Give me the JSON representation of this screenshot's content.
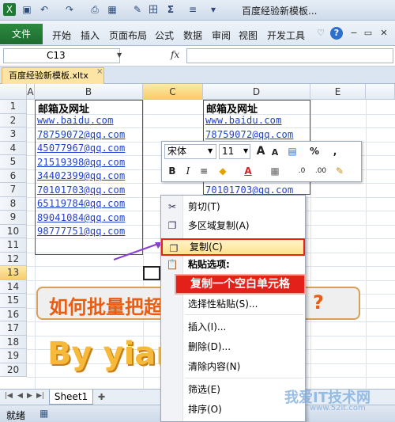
{
  "window": {
    "title": "百度经验新模板...",
    "quick_access": [
      "save-icon",
      "undo-icon",
      "redo-icon",
      "print-preview-icon",
      "table-icon",
      "format-painter-icon",
      "border-icon",
      "sum-icon",
      "align-icon"
    ],
    "sum_glyph": "Σ"
  },
  "ribbon": {
    "file_tab": "文件",
    "tabs": [
      "开始",
      "插入",
      "页面布局",
      "公式",
      "数据",
      "审阅",
      "视图",
      "开发工具"
    ],
    "accent": "#1e6c2f"
  },
  "formula_bar": {
    "name_box": "C13",
    "fx": "fx",
    "formula": ""
  },
  "workbook": {
    "tab_name": "百度经验新模板.xltx",
    "close_glyph": "×"
  },
  "grid": {
    "columns": [
      "A",
      "B",
      "C",
      "D",
      "E"
    ],
    "rows": [
      "1",
      "2",
      "3",
      "4",
      "5",
      "6",
      "7",
      "8",
      "9",
      "10",
      "11",
      "12",
      "13",
      "14",
      "15",
      "16",
      "17",
      "18",
      "19",
      "20"
    ],
    "selected_column": "C",
    "selected_row": "13",
    "table_b": {
      "header": "邮箱及网址",
      "items": [
        "www.baidu.com",
        "78759072@qq.com",
        "45077967@qq.com",
        "21519398@qq.com",
        "34402399@qq.com",
        "70101703@qq.com",
        "65119784@qq.com",
        "89041084@qq.com",
        "98777751@qq.com"
      ]
    },
    "table_d": {
      "header": "邮箱及网址",
      "items": [
        "www.baidu.com",
        "78759072@qq.com",
        "70101703@qq.com"
      ]
    },
    "banner_text": "如何批量把超",
    "banner_mark": "?",
    "big_text": "By yian"
  },
  "mini_toolbar": {
    "font": "宋体",
    "size": "11",
    "row1_buttons": [
      "A",
      "A",
      "%",
      ","
    ],
    "row2_buttons": [
      "B",
      "I",
      "≡",
      "A"
    ]
  },
  "context_menu": {
    "items": [
      {
        "label": "剪切(T)",
        "icon": "scissors-icon"
      },
      {
        "label": "多区域复制(A)",
        "icon": "multi-copy-icon"
      },
      {
        "label": "复制(C)",
        "icon": "copy-icon"
      },
      {
        "label": "粘贴选项:",
        "icon": "paste-icon"
      },
      {
        "label": "选择性粘贴(S)...",
        "icon": ""
      },
      {
        "label": "插入(I)...",
        "icon": ""
      },
      {
        "label": "删除(D)...",
        "icon": ""
      },
      {
        "label": "清除内容(N)",
        "icon": ""
      },
      {
        "label": "筛选(E)",
        "icon": ""
      },
      {
        "label": "排序(O)",
        "icon": ""
      }
    ],
    "highlight_color": "#e8241b"
  },
  "annotation": "复制一个空白单元格",
  "sheets": {
    "active": "Sheet1"
  },
  "status": {
    "text": "就绪"
  },
  "watermark": {
    "text": "我爱IT技术网",
    "sub": "www.52it.com"
  }
}
